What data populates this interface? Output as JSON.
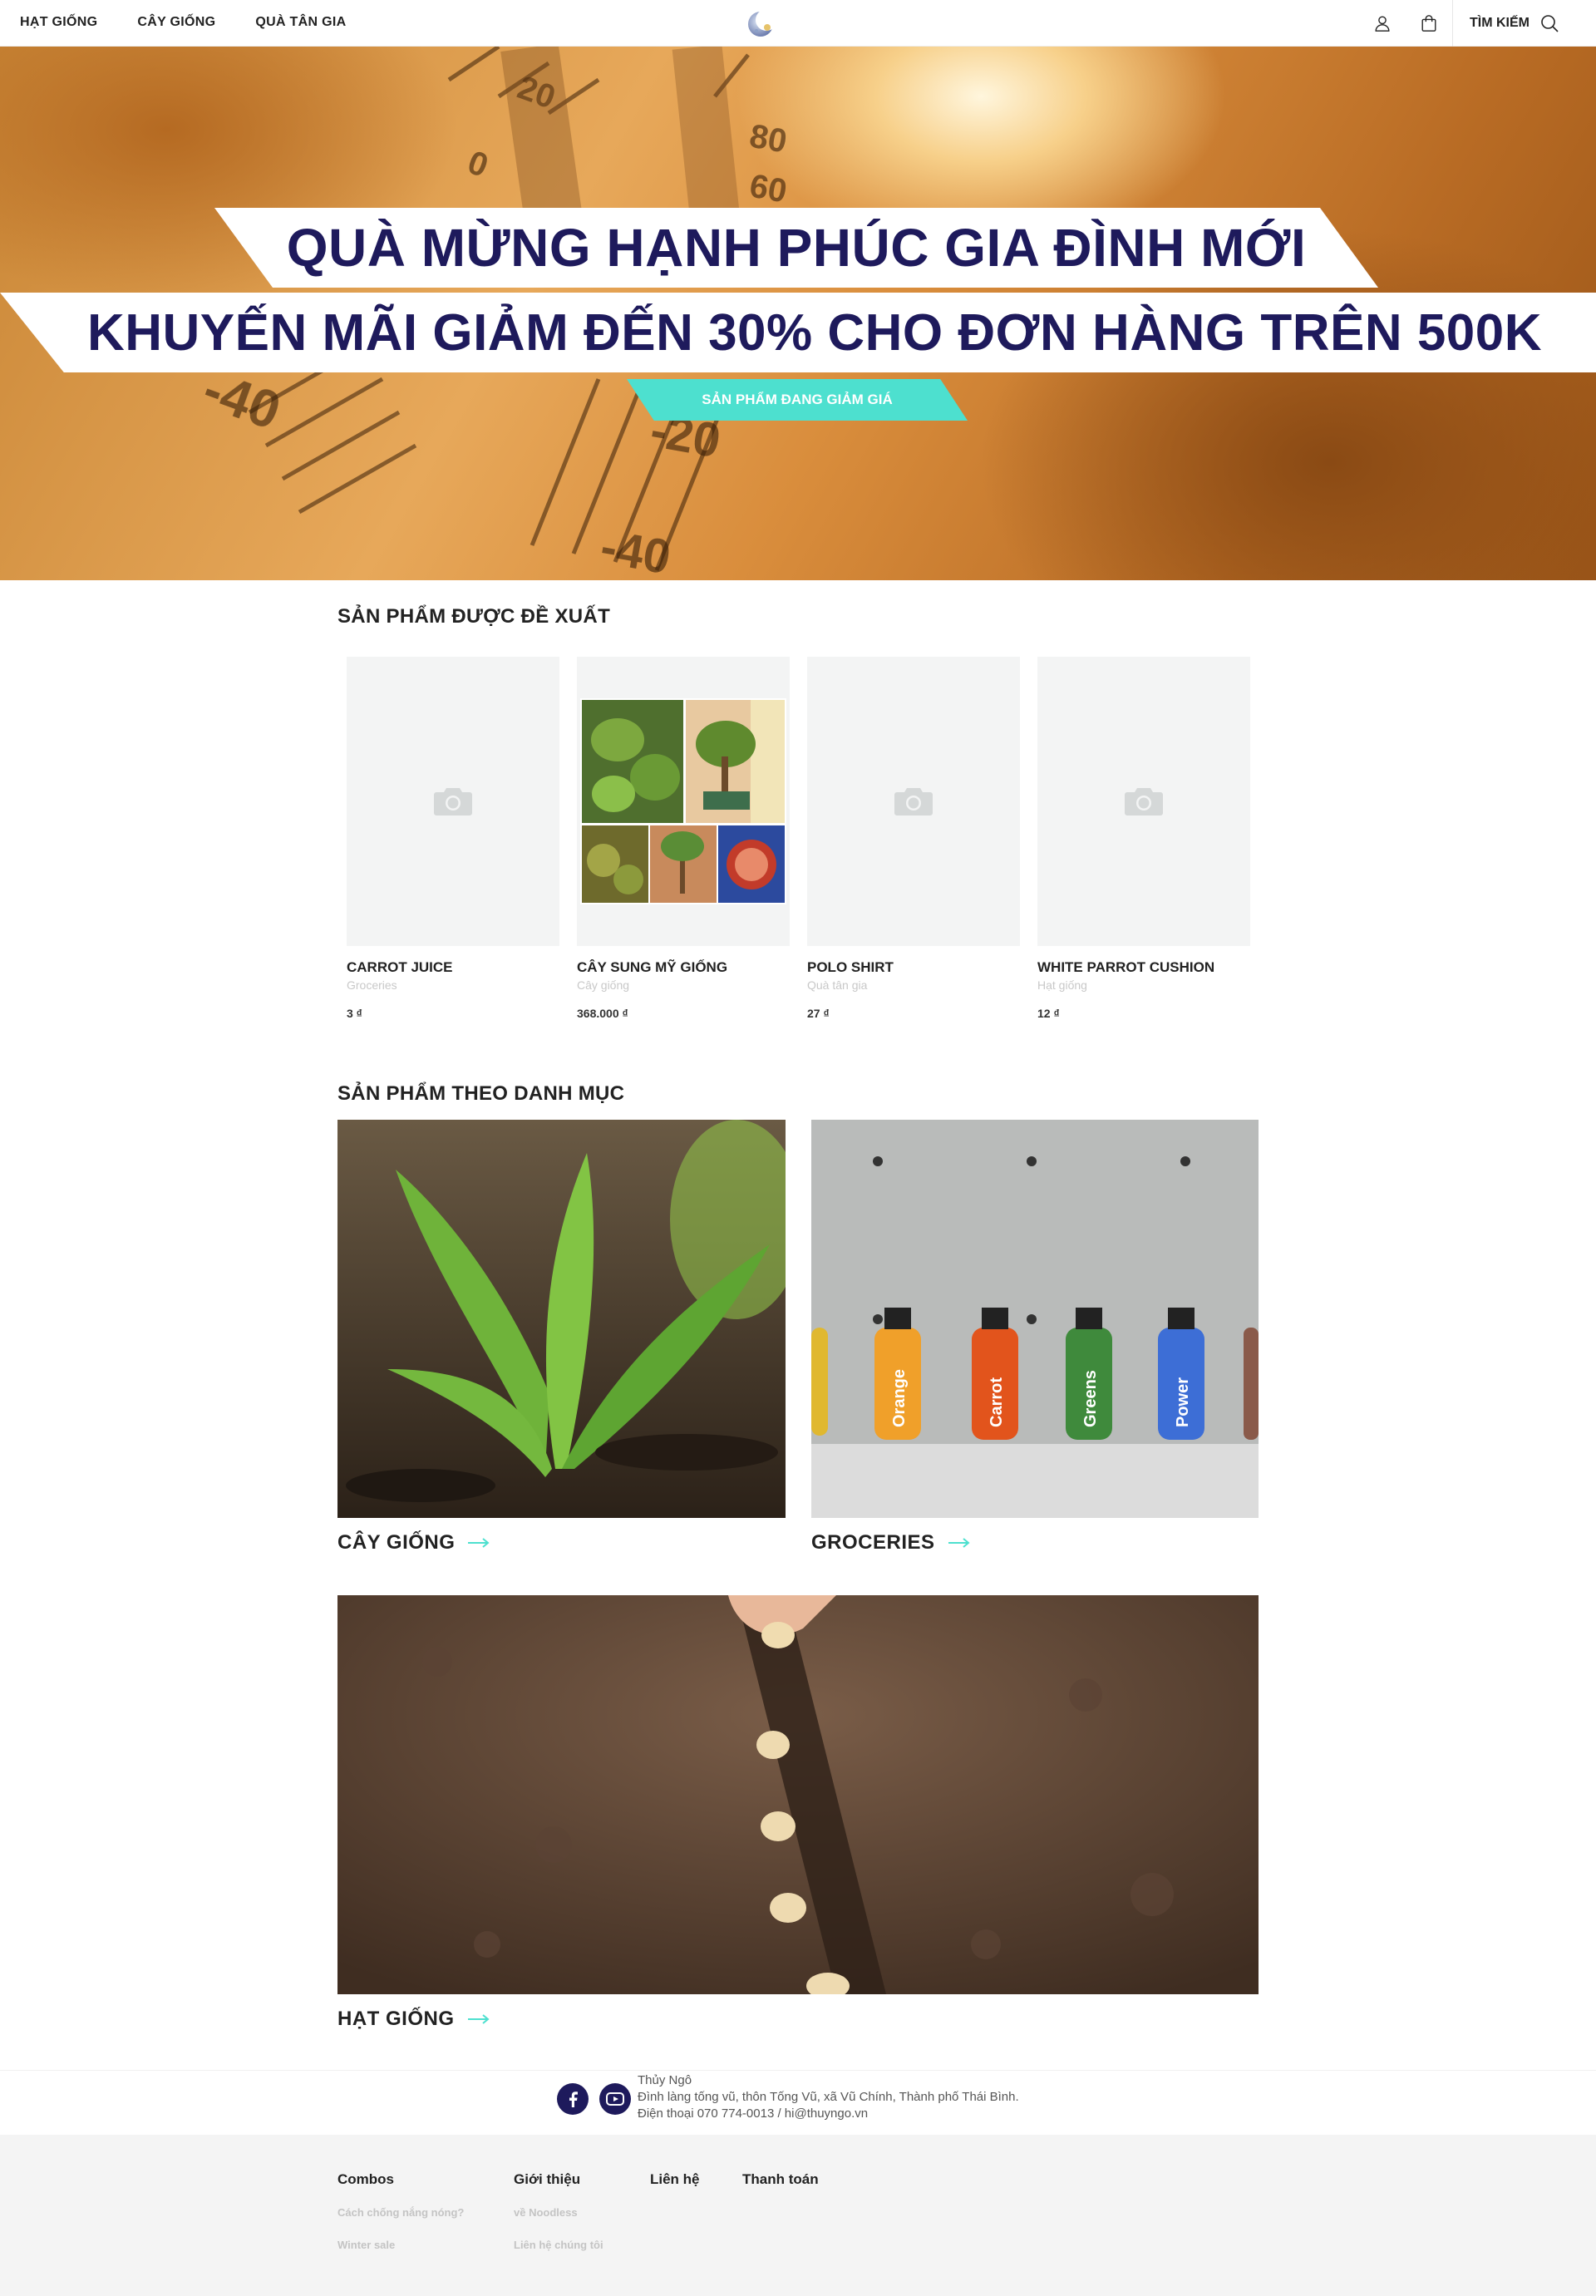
{
  "header": {
    "nav": [
      "HẠT GIỐNG",
      "CÂY GIỐNG",
      "QUÀ TÂN GIA"
    ],
    "search_label": "TÌM KIẾM",
    "icons": [
      "user-icon",
      "shopping-bag-icon",
      "search-icon"
    ]
  },
  "hero": {
    "line1": "QUÀ MỪNG HẠNH PHÚC GIA ĐÌNH MỚI",
    "line2": "KHUYẾN MÃI GIẢM ĐẾN 30% CHO ĐƠN HÀNG TRÊN 500K",
    "cta": "SẢN PHẨM ĐANG GIẢM GIÁ",
    "colors": {
      "banner_text": "#1e1a5c",
      "cta_bg": "#4de0cf"
    }
  },
  "recommended": {
    "title": "SẢN PHẨM ĐƯỢC ĐỀ XUẤT",
    "products": [
      {
        "name": "CARROT JUICE",
        "category": "Groceries",
        "price": "3 ₫",
        "has_image": false
      },
      {
        "name": "CÂY SUNG MỸ GIỐNG",
        "category": "Cây giống",
        "price": "368.000 ₫",
        "has_image": true
      },
      {
        "name": "POLO SHIRT",
        "category": "Quà tân gia",
        "price": "27 ₫",
        "has_image": false
      },
      {
        "name": "WHITE PARROT CUSHION",
        "category": "Hạt giống",
        "price": "12 ₫",
        "has_image": false
      }
    ]
  },
  "categories": {
    "title": "SẢN PHẨM THEO DANH MỤC",
    "items": [
      "CÂY GIỐNG",
      "GROCERIES",
      "HẠT GIỐNG"
    ],
    "bottle_labels": [
      "Orange",
      "Carrot",
      "Greens",
      "Power"
    ]
  },
  "contact": {
    "name": "Thủy Ngô",
    "address": "Đình làng tống vũ, thôn Tống Vũ, xã Vũ Chính, Thành phố Thái Bình.",
    "phone": "Điện thoại 070 774-0013 / hi@thuyngo.vn",
    "social": [
      "facebook-icon",
      "youtube-icon"
    ]
  },
  "footer": {
    "columns": [
      {
        "title": "Combos",
        "links": [
          "Cách chống nắng nóng?",
          "Winter sale"
        ]
      },
      {
        "title": "Giới thiệu",
        "links": [
          "về Noodless",
          "Liên hệ chúng tôi"
        ]
      },
      {
        "title": "Liên hệ",
        "links": []
      },
      {
        "title": "Thanh toán",
        "links": []
      }
    ]
  }
}
